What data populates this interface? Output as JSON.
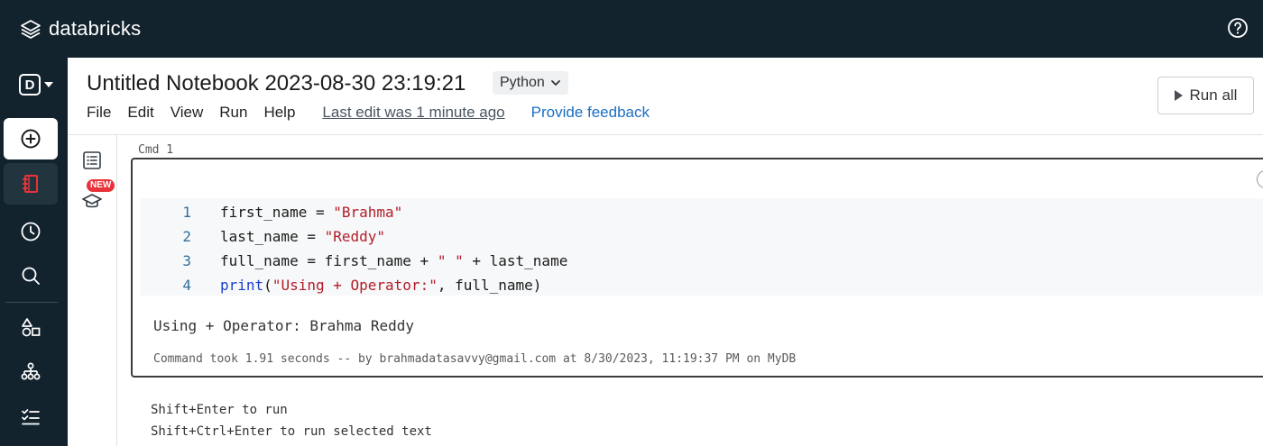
{
  "app": {
    "brand": "databricks",
    "help_icon": "help-circle-icon"
  },
  "sidebar": {
    "workspace_initial": "D",
    "items": [
      {
        "name": "create",
        "icon": "plus-circle-icon"
      },
      {
        "name": "notebook",
        "icon": "notebook-icon",
        "active": true
      },
      {
        "name": "recents",
        "icon": "clock-icon"
      },
      {
        "name": "search",
        "icon": "search-icon"
      },
      {
        "name": "catalog",
        "icon": "shapes-icon"
      },
      {
        "name": "workflows",
        "icon": "workflow-icon"
      },
      {
        "name": "tasks",
        "icon": "checklist-icon"
      }
    ]
  },
  "rail": {
    "new_badge": "NEW",
    "icons": [
      "table-of-contents-icon",
      "graduation-cap-icon"
    ]
  },
  "notebook": {
    "title": "Untitled Notebook 2023-08-30 23:19:21",
    "language": "Python",
    "menu": [
      "File",
      "Edit",
      "View",
      "Run",
      "Help"
    ],
    "last_edit": "Last edit was 1 minute ago",
    "feedback": "Provide feedback",
    "run_all": "Run all"
  },
  "cell": {
    "label": "Cmd  1",
    "lines": [
      {
        "no": "1",
        "pre": "first_name = ",
        "str": "\"Brahma\""
      },
      {
        "no": "2",
        "pre": "last_name = ",
        "str": "\"Reddy\""
      },
      {
        "no": "3",
        "pre": "full_name = first_name + ",
        "str": "\" \"",
        "post": " + last_name"
      },
      {
        "no": "4",
        "kw": "print",
        "open": "(",
        "str": "\"Using + Operator:\"",
        "post": ", full_name)"
      }
    ],
    "output": "Using + Operator: Brahma Reddy",
    "command_took": "Command took 1.91 seconds -- by brahmadatasavvy@gmail.com at 8/30/2023, 11:19:37 PM on MyDB"
  },
  "hints": [
    "Shift+Enter to run",
    "Shift+Ctrl+Enter to run selected text"
  ],
  "colors": {
    "topbar": "#13232e",
    "accent_red": "#e8333a",
    "link_blue": "#1a6fc4",
    "string_red": "#b31d28",
    "keyword_blue": "#1d3fcf"
  }
}
